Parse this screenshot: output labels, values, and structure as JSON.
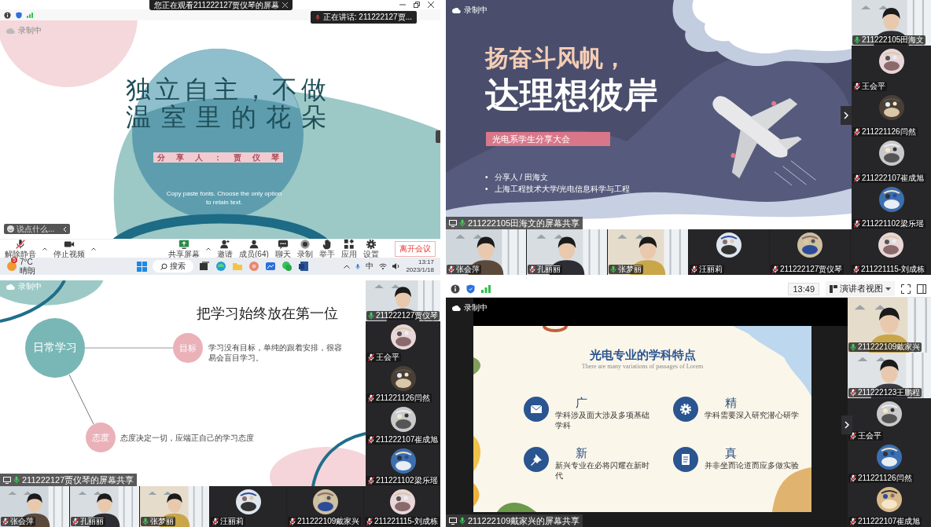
{
  "top_left": {
    "title_bar": {
      "title": "您正在观看211222127贾仪琴的屏幕"
    },
    "speaker": "正在讲话: 211222127贾...",
    "recording": "录制中",
    "slide": {
      "title_lines": [
        "独立自主，不做",
        "温室里的花朵"
      ],
      "presenter": "分 享 人 ： 贾 仪 琴",
      "note_lines": [
        "Copy paste fonts. Choose the only option",
        "to retain text."
      ]
    },
    "chat": {
      "placeholder": "说点什么..."
    },
    "toolbar": [
      {
        "kind": "mic",
        "label": "解除静音"
      },
      {
        "kind": "camera",
        "label": "停止视频"
      },
      {
        "kind": "share",
        "label": "共享屏幕"
      },
      {
        "kind": "invite",
        "label": "邀请"
      },
      {
        "kind": "members",
        "label": "成员(64)"
      },
      {
        "kind": "chat",
        "label": "聊天"
      },
      {
        "kind": "record",
        "label": "录制"
      },
      {
        "kind": "hand",
        "label": "举手"
      },
      {
        "kind": "apps",
        "label": "应用"
      },
      {
        "kind": "settings",
        "label": "设置"
      }
    ],
    "leave_button": "离开会议",
    "taskbar": {
      "badge": "5",
      "temperature": "7°C",
      "weather": "晴朗",
      "search": "搜索",
      "ime": "中",
      "time": "13:17",
      "date": "2023/1/18"
    }
  },
  "top_right": {
    "recording": "录制中",
    "slide": {
      "kind": "sail",
      "title_lines": [
        "扬奋斗风帆，",
        "达理想彼岸"
      ],
      "tag": "光电系学生分享大会",
      "bullet_marker": "•",
      "bullets": [
        "分享人 / 田海文",
        "上海工程技术大学/光电信息科学与工程"
      ]
    },
    "share_label": "211222105田海文的屏幕共享",
    "sidebar": [
      {
        "name": "211222105田海文",
        "kind": "video",
        "muted": false
      },
      {
        "name": "王会平",
        "kind": "avatar",
        "muted": true
      },
      {
        "name": "211221126闫然",
        "kind": "avatar",
        "muted": true
      },
      {
        "name": "211222107崔成旭",
        "kind": "avatar",
        "muted": true
      },
      {
        "name": "211221102梁乐瑶",
        "kind": "avatar",
        "muted": true
      }
    ],
    "strip": [
      {
        "name": "张会萍",
        "kind": "video",
        "muted": true
      },
      {
        "name": "孔丽丽",
        "kind": "video",
        "muted": true
      },
      {
        "name": "张梦丽",
        "kind": "video",
        "muted": false
      },
      {
        "name": "汪丽莉",
        "kind": "avatar",
        "muted": true
      },
      {
        "name": "211222127贾仪琴",
        "kind": "avatar",
        "muted": true
      },
      {
        "name": "211221115-刘成栋",
        "kind": "avatar",
        "muted": true
      }
    ]
  },
  "bottom_left": {
    "recording": "录制中",
    "slide": {
      "kind": "mindmap",
      "title": "把学习始终放在第一位",
      "center": "日常学习",
      "nodes": [
        {
          "label": "目标",
          "text": "学习没有目标，单纯的跟着安排，很容易会盲目学习。"
        },
        {
          "label": "态度",
          "text": "态度决定一切，应端正自己的学习态度"
        }
      ]
    },
    "share_label": "211222127贾仪琴的屏幕共享",
    "sidebar": [
      {
        "name": "211222127贾仪琴",
        "kind": "video",
        "muted": false
      },
      {
        "name": "王会平",
        "kind": "avatar",
        "muted": true
      },
      {
        "name": "211221126闫然",
        "kind": "avatar",
        "muted": true
      },
      {
        "name": "211222107崔成旭",
        "kind": "avatar",
        "muted": true
      },
      {
        "name": "211221102梁乐瑶",
        "kind": "avatar",
        "muted": true
      }
    ],
    "strip": [
      {
        "name": "张会萍",
        "kind": "video",
        "muted": true
      },
      {
        "name": "孔丽丽",
        "kind": "video",
        "muted": true
      },
      {
        "name": "张梦丽",
        "kind": "video",
        "muted": false
      },
      {
        "name": "汪丽莉",
        "kind": "avatar",
        "muted": true
      },
      {
        "name": "211222109戴家兴",
        "kind": "avatar",
        "muted": true
      },
      {
        "name": "211221115-刘成栋",
        "kind": "avatar",
        "muted": true
      }
    ]
  },
  "bottom_right": {
    "toolbar": {
      "time": "13:49",
      "view": "演讲者视图"
    },
    "recording": "录制中",
    "slide": {
      "kind": "features",
      "title": "光电专业的学科特点",
      "subtitle": "There are many variations of passages of Lorem",
      "items": [
        {
          "kind": "mail",
          "heading": "广",
          "text": "学科涉及面大涉及多项基础学科"
        },
        {
          "kind": "gear",
          "heading": "精",
          "text": "学科需要深入研究潜心研学"
        },
        {
          "kind": "pin",
          "heading": "新",
          "text": "新兴专业在必将闪耀在新时代"
        },
        {
          "kind": "book",
          "heading": "真",
          "text": "并非坐而论道而应多做实验"
        }
      ]
    },
    "share_label": "211222109戴家兴的屏幕共享",
    "sidebar": [
      {
        "name": "211222109戴家兴",
        "kind": "video",
        "muted": false
      },
      {
        "name": "211222123王鹏程",
        "kind": "video",
        "muted": true
      },
      {
        "name": "王会平",
        "kind": "avatar",
        "muted": true
      },
      {
        "name": "211221126闫然",
        "kind": "avatar",
        "muted": true
      },
      {
        "name": "211222107崔成旭",
        "kind": "avatar",
        "muted": true
      }
    ]
  }
}
